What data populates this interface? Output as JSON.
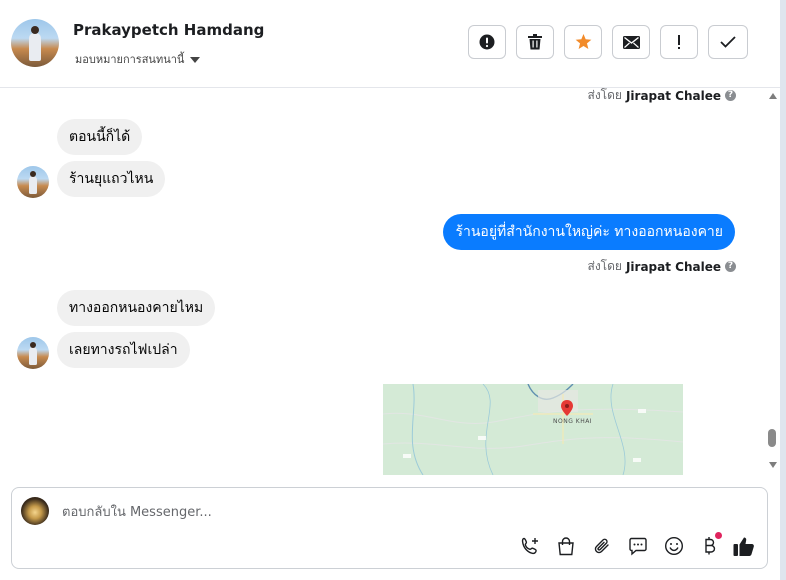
{
  "header": {
    "contact_name": "Prakaypetch Hamdang",
    "assign_label": "มอบหมายการสนทนานี้",
    "actions": [
      {
        "name": "alert-button",
        "icon": "exclamation-circle-icon"
      },
      {
        "name": "delete-button",
        "icon": "trash-icon"
      },
      {
        "name": "star-button",
        "icon": "star-icon",
        "active_color": "#f28b2a"
      },
      {
        "name": "mail-button",
        "icon": "envelope-icon"
      },
      {
        "name": "spam-button",
        "icon": "exclamation-icon"
      },
      {
        "name": "done-button",
        "icon": "check-icon"
      }
    ]
  },
  "messages": {
    "sent_prefix": "ส่งโดย",
    "sent_agent": "Jirapat Chalee",
    "incoming_1a": "ตอนนี้ก็ได้",
    "incoming_1b": "ร้านยุแถวไหน",
    "outgoing_1": "ร้านอยู่ที่สำนักงานใหญ่ค่ะ ทางออกหนองคาย",
    "incoming_2a": "ทางออกหนองคายไหม",
    "incoming_2b": "เลยทางรถไฟเปล่า",
    "map_place_label": "NONG KHAI"
  },
  "composer": {
    "placeholder": "ตอบกลับใน Messenger...",
    "tools": [
      "phone-plus-icon",
      "shopping-bag-icon",
      "paperclip-icon",
      "chat-bubble-icon",
      "smiley-icon",
      "baht-icon",
      "thumbs-up-icon"
    ]
  },
  "colors": {
    "outgoing_bubble": "#0a7cff",
    "incoming_bubble": "#f0f0f0",
    "star": "#f28b2a",
    "notification": "#e0245e"
  }
}
